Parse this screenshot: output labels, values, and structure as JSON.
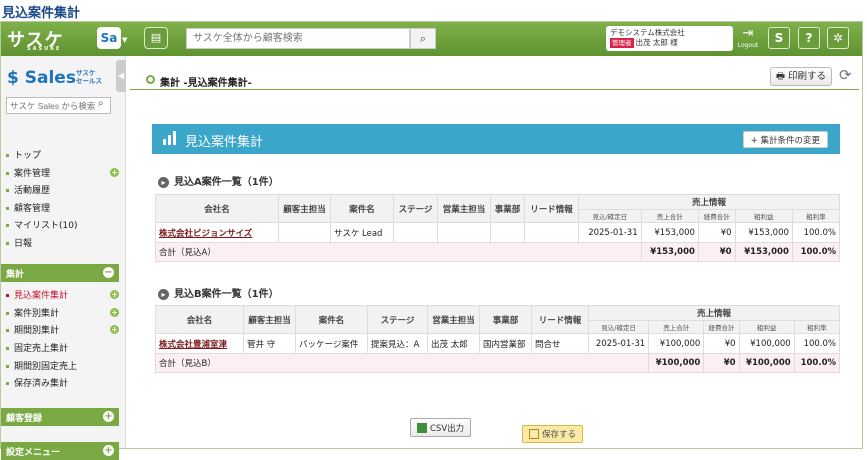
{
  "page_title": "見込案件集計",
  "header": {
    "logo": "サスケ",
    "logo_sub": "SASUKE",
    "sa_label": "Sa",
    "search_placeholder": "サスケ全体から顧客検索",
    "company": "デモシステム株式会社",
    "role": "管理者",
    "user": "出茂 太郎 様",
    "logout": "Logout"
  },
  "sidebar": {
    "brand": "Sales",
    "brand_sub1": "サスケ",
    "brand_sub2": "セールス",
    "search_placeholder": "サスケ Sales から検索",
    "items": [
      {
        "label": "トップ"
      },
      {
        "label": "案件管理"
      },
      {
        "label": "活動履歴"
      },
      {
        "label": "顧客管理"
      },
      {
        "label": "マイリスト(10)"
      },
      {
        "label": "日報"
      }
    ],
    "section_total": "集計",
    "total_items": [
      {
        "label": "見込案件集計"
      },
      {
        "label": "案件別集計"
      },
      {
        "label": "期間別集計"
      },
      {
        "label": "固定売上集計"
      },
      {
        "label": "期間別固定売上"
      },
      {
        "label": "保存済み集計"
      }
    ],
    "section_customer": "顧客登録",
    "section_settings": "設定メニュー"
  },
  "main": {
    "breadcrumb": "集計 -見込案件集計-",
    "print": "印刷する",
    "banner_title": "見込案件集計",
    "change_conditions": "+ 集計条件の変更",
    "csv": "CSV出力",
    "save": "保存する"
  },
  "table_headers": {
    "company": "会社名",
    "customer_rep": "顧客主担当",
    "deal": "案件名",
    "stage": "ステージ",
    "sales_rep": "営業主担当",
    "division": "事業部",
    "lead": "リード情報",
    "sales_info": "売上情報",
    "date": "見込/確定日",
    "sales_total": "売上合計",
    "expense_total": "経費合計",
    "gross_profit": "粗利益",
    "margin": "粗利率"
  },
  "section_a": {
    "title": "見込A案件一覧（1件）",
    "row": {
      "company": "株式会社ビジョンサイズ",
      "customer_rep": "",
      "deal": "サスケ Lead",
      "stage": "",
      "sales_rep": "",
      "division": "",
      "lead": "",
      "date": "2025-01-31",
      "sales_total": "¥153,000",
      "expense_total": "¥0",
      "gross_profit": "¥153,000",
      "margin": "100.0%"
    },
    "total": {
      "label": "合計（見込A）",
      "sales_total": "¥153,000",
      "expense_total": "¥0",
      "gross_profit": "¥153,000",
      "margin": "100.0%"
    }
  },
  "section_b": {
    "title": "見込B案件一覧（1件）",
    "row": {
      "company": "株式会社豊浦室津",
      "customer_rep": "菅井 守",
      "deal": "パッケージ案件",
      "stage": "提案見込：A",
      "sales_rep": "出茂 太郎",
      "division": "国内営業部",
      "lead": "問合せ",
      "date": "2025-01-31",
      "sales_total": "¥100,000",
      "expense_total": "¥0",
      "gross_profit": "¥100,000",
      "margin": "100.0%"
    },
    "total": {
      "label": "合計（見込B）",
      "sales_total": "¥100,000",
      "expense_total": "¥0",
      "gross_profit": "¥100,000",
      "margin": "100.0%"
    }
  },
  "colors": {
    "header_green": "#6aa03a",
    "banner_blue": "#3aa6c9",
    "active_red": "#c8102e",
    "total_pink": "#fceff3"
  }
}
